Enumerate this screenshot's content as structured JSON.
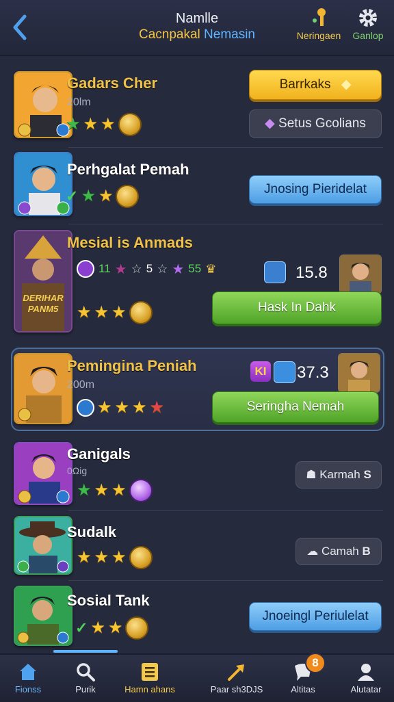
{
  "header": {
    "title": "Namlle",
    "subtitle_a": "Cacnpakal",
    "subtitle_b": "Nemasin",
    "right1_label": "Neringaen",
    "right2_label": "Ganlop"
  },
  "rows": [
    {
      "name": "Gadars Cher",
      "sub": "20lm",
      "button": "Barrkaks",
      "button2": "Setus Gcolians"
    },
    {
      "name": "Perhgalat Pemah",
      "button": "Jnosing Pieridelat"
    },
    {
      "name": "Mesial is Anmads",
      "stat1": "11",
      "stat2": "5",
      "stat3": "55",
      "value": "15.8",
      "button": "Hask In Dahk",
      "portrait_text": "DERIHAR PANM5"
    },
    {
      "name": "Pemingina Peniah",
      "sub": "200m",
      "value": "37.3",
      "button": "Seringha Nemah",
      "badge_text": "KI"
    },
    {
      "name": "Ganigals",
      "sub": "0Ωig",
      "button": "Karmah",
      "button_suffix": "S"
    },
    {
      "name": "Sudalk",
      "button": "Camah",
      "button_suffix": "B"
    },
    {
      "name": "Sosial Tank",
      "button": "Jnoeingl Periulelat"
    }
  ],
  "tabs": [
    {
      "label": "Fionss",
      "icon": "home-icon"
    },
    {
      "label": "Purik",
      "icon": "search-icon"
    },
    {
      "label": "Hamn ahans",
      "icon": "list-icon"
    },
    {
      "label": "Paar sh3DJS",
      "icon": "arrow-icon"
    },
    {
      "label": "Altitas",
      "icon": "chat-icon"
    },
    {
      "label": "Alutatar",
      "icon": "profile-icon"
    }
  ],
  "notification_count": "8",
  "colors": {
    "accent_gold": "#f2c94c",
    "accent_blue": "#5fb4ff",
    "green_button": "#5eb233",
    "yellow_button": "#f6c22b"
  }
}
